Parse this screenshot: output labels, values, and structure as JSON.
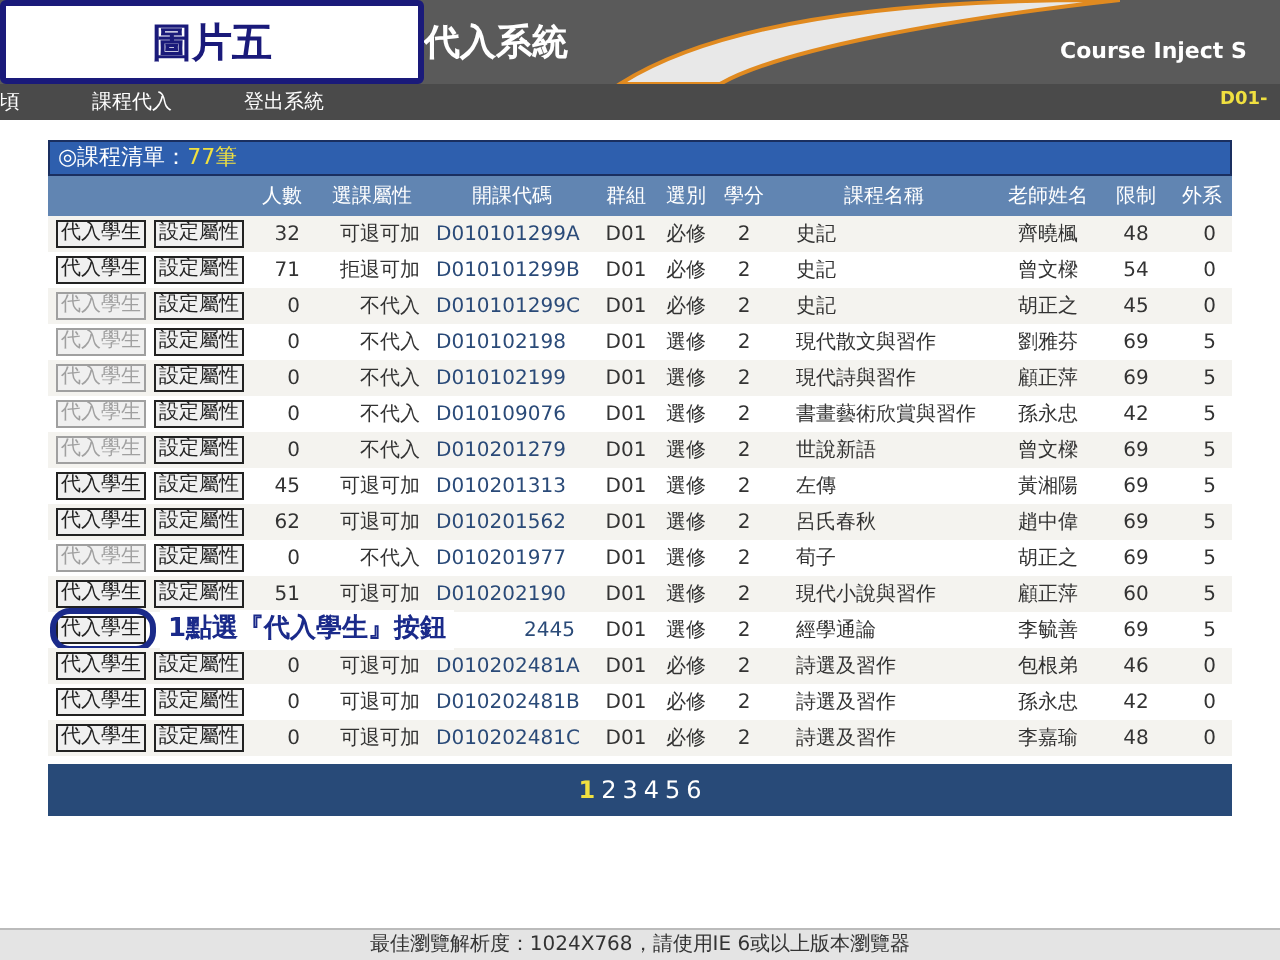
{
  "header": {
    "title": "代入系統",
    "subtitle": "Course Inject S"
  },
  "nav": {
    "items": [
      "頃",
      "課程代入",
      "登出系統"
    ],
    "right": "D01-"
  },
  "list": {
    "title": "◎課程清單：",
    "count": "77筆"
  },
  "columns": [
    "人數",
    "選課屬性",
    "開課代碼",
    "群組",
    "選別",
    "學分",
    "課程名稱",
    "老師姓名",
    "限制",
    "外系"
  ],
  "rows": [
    {
      "inject": {
        "label": "代入學生",
        "disabled": false
      },
      "setting": "設定屬性",
      "count": "32",
      "attribute": "可退可加",
      "code": "D010101299A",
      "group": "D01",
      "type": "必修",
      "credits": "2",
      "course": "史記",
      "teacher": "齊曉楓",
      "limit": "48",
      "external": "0",
      "circled": false
    },
    {
      "inject": {
        "label": "代入學生",
        "disabled": false
      },
      "setting": "設定屬性",
      "count": "71",
      "attribute": "拒退可加",
      "code": "D010101299B",
      "group": "D01",
      "type": "必修",
      "credits": "2",
      "course": "史記",
      "teacher": "曾文樑",
      "limit": "54",
      "external": "0",
      "circled": false
    },
    {
      "inject": {
        "label": "代入學生",
        "disabled": true
      },
      "setting": "設定屬性",
      "count": "0",
      "attribute": "不代入",
      "code": "D010101299C",
      "group": "D01",
      "type": "必修",
      "credits": "2",
      "course": "史記",
      "teacher": "胡正之",
      "limit": "45",
      "external": "0",
      "circled": false
    },
    {
      "inject": {
        "label": "代入學生",
        "disabled": true
      },
      "setting": "設定屬性",
      "count": "0",
      "attribute": "不代入",
      "code": "D010102198",
      "group": "D01",
      "type": "選修",
      "credits": "2",
      "course": "現代散文與習作",
      "teacher": "劉雅芬",
      "limit": "69",
      "external": "5",
      "circled": false
    },
    {
      "inject": {
        "label": "代入學生",
        "disabled": true
      },
      "setting": "設定屬性",
      "count": "0",
      "attribute": "不代入",
      "code": "D010102199",
      "group": "D01",
      "type": "選修",
      "credits": "2",
      "course": "現代詩與習作",
      "teacher": "顧正萍",
      "limit": "69",
      "external": "5",
      "circled": false
    },
    {
      "inject": {
        "label": "代入學生",
        "disabled": true
      },
      "setting": "設定屬性",
      "count": "0",
      "attribute": "不代入",
      "code": "D010109076",
      "group": "D01",
      "type": "選修",
      "credits": "2",
      "course": "書畫藝術欣賞與習作",
      "teacher": "孫永忠",
      "limit": "42",
      "external": "5",
      "circled": false
    },
    {
      "inject": {
        "label": "代入學生",
        "disabled": true
      },
      "setting": "設定屬性",
      "count": "0",
      "attribute": "不代入",
      "code": "D010201279",
      "group": "D01",
      "type": "選修",
      "credits": "2",
      "course": "世說新語",
      "teacher": "曾文樑",
      "limit": "69",
      "external": "5",
      "circled": false
    },
    {
      "inject": {
        "label": "代入學生",
        "disabled": false
      },
      "setting": "設定屬性",
      "count": "45",
      "attribute": "可退可加",
      "code": "D010201313",
      "group": "D01",
      "type": "選修",
      "credits": "2",
      "course": "左傳",
      "teacher": "黃湘陽",
      "limit": "69",
      "external": "5",
      "circled": false
    },
    {
      "inject": {
        "label": "代入學生",
        "disabled": false
      },
      "setting": "設定屬性",
      "count": "62",
      "attribute": "可退可加",
      "code": "D010201562",
      "group": "D01",
      "type": "選修",
      "credits": "2",
      "course": "呂氏春秋",
      "teacher": "趙中偉",
      "limit": "69",
      "external": "5",
      "circled": false
    },
    {
      "inject": {
        "label": "代入學生",
        "disabled": true
      },
      "setting": "設定屬性",
      "count": "0",
      "attribute": "不代入",
      "code": "D010201977",
      "group": "D01",
      "type": "選修",
      "credits": "2",
      "course": "荀子",
      "teacher": "胡正之",
      "limit": "69",
      "external": "5",
      "circled": false
    },
    {
      "inject": {
        "label": "代入學生",
        "disabled": false
      },
      "setting": "設定屬性",
      "count": "51",
      "attribute": "可退可加",
      "code": "D010202190",
      "group": "D01",
      "type": "選修",
      "credits": "2",
      "course": "現代小說與習作",
      "teacher": "顧正萍",
      "limit": "60",
      "external": "5",
      "circled": false
    },
    {
      "inject": {
        "label": "代入學生",
        "disabled": false
      },
      "code": "2445",
      "group": "D01",
      "type": "選修",
      "credits": "2",
      "course": "經學通論",
      "teacher": "李毓善",
      "limit": "69",
      "external": "5",
      "circled": true
    },
    {
      "inject": {
        "label": "代入學生",
        "disabled": false
      },
      "setting": "設定屬性",
      "count": "0",
      "attribute": "可退可加",
      "code": "D010202481A",
      "group": "D01",
      "type": "必修",
      "credits": "2",
      "course": "詩選及習作",
      "teacher": "包根弟",
      "limit": "46",
      "external": "0",
      "circled": false
    },
    {
      "inject": {
        "label": "代入學生",
        "disabled": false
      },
      "setting": "設定屬性",
      "count": "0",
      "attribute": "可退可加",
      "code": "D010202481B",
      "group": "D01",
      "type": "必修",
      "credits": "2",
      "course": "詩選及習作",
      "teacher": "孫永忠",
      "limit": "42",
      "external": "0",
      "circled": false
    },
    {
      "inject": {
        "label": "代入學生",
        "disabled": false
      },
      "setting": "設定屬性",
      "count": "0",
      "attribute": "可退可加",
      "code": "D010202481C",
      "group": "D01",
      "type": "必修",
      "credits": "2",
      "course": "詩選及習作",
      "teacher": "李嘉瑜",
      "limit": "48",
      "external": "0",
      "circled": false
    }
  ],
  "pages": [
    {
      "label": "1",
      "selected": true
    },
    {
      "label": "2",
      "selected": false
    },
    {
      "label": "3",
      "selected": false
    },
    {
      "label": "4",
      "selected": false
    },
    {
      "label": "5",
      "selected": false
    },
    {
      "label": "6",
      "selected": false
    }
  ],
  "footer": "最佳瀏覽解析度：1024X768，請使用IE 6或以上版本瀏覽器",
  "annotation": {
    "label": "圖片五",
    "callout": "1點選『代入學生』按鈕"
  }
}
